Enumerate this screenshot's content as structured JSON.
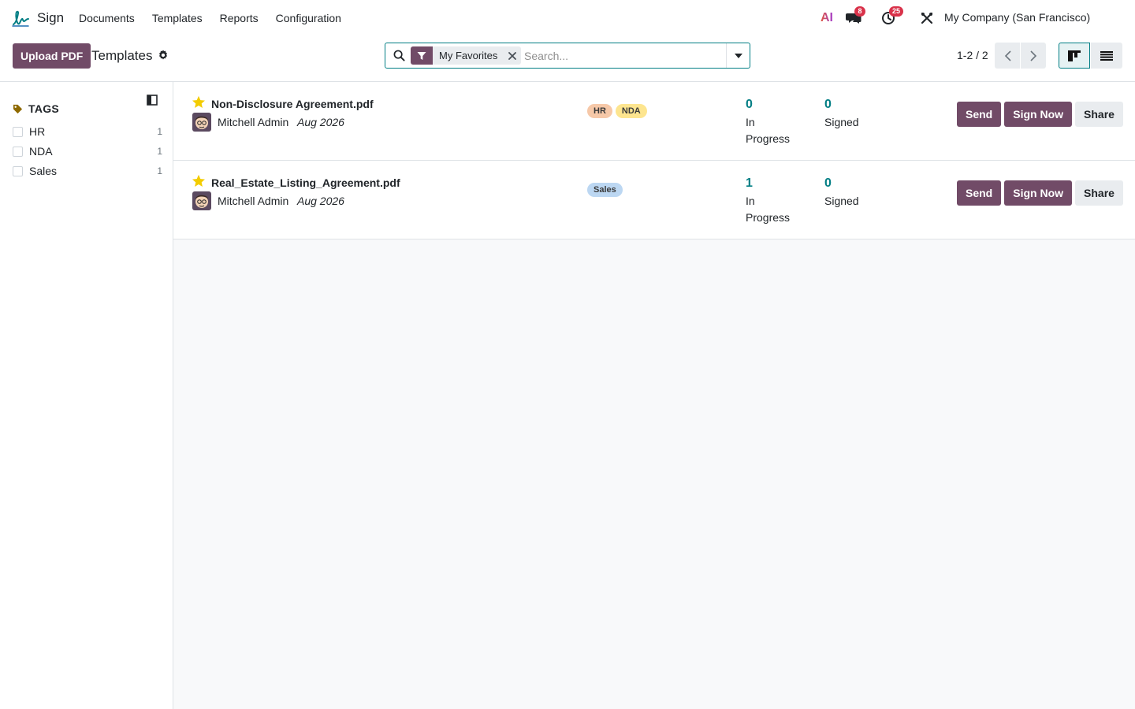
{
  "navbar": {
    "app_name": "Sign",
    "menu": [
      "Documents",
      "Templates",
      "Reports",
      "Configuration"
    ],
    "ai_label": "AI",
    "messages_badge": "8",
    "activities_badge": "25",
    "company": "My Company (San Francisco)"
  },
  "control": {
    "upload_label": "Upload PDF",
    "title": "Templates",
    "facet_label": "My Favorites",
    "search_placeholder": "Search...",
    "pager": "1-2 / 2"
  },
  "sidebar": {
    "title": "TAGS",
    "tags": [
      {
        "label": "HR",
        "count": "1"
      },
      {
        "label": "NDA",
        "count": "1"
      },
      {
        "label": "Sales",
        "count": "1"
      }
    ]
  },
  "records": [
    {
      "name": "Non-Disclosure Agreement.pdf",
      "user": "Mitchell Admin",
      "date": "Aug 2026",
      "tags": [
        {
          "label": "HR",
          "color": "#f6c8a8"
        },
        {
          "label": "NDA",
          "color": "#fde58f"
        }
      ],
      "in_progress": "0",
      "in_progress_label": "In Progress",
      "signed": "0",
      "signed_label": "Signed",
      "actions": [
        "Send",
        "Sign Now",
        "Share"
      ]
    },
    {
      "name": "Real_Estate_Listing_Agreement.pdf",
      "user": "Mitchell Admin",
      "date": "Aug 2026",
      "tags": [
        {
          "label": "Sales",
          "color": "#bcd7f2"
        }
      ],
      "in_progress": "1",
      "in_progress_label": "In Progress",
      "signed": "0",
      "signed_label": "Signed",
      "actions": [
        "Send",
        "Sign Now",
        "Share"
      ]
    }
  ],
  "colors": {
    "brand": "#714b67",
    "accent": "#017e84",
    "star": "#f3cc00",
    "badge": "#d9324a"
  }
}
